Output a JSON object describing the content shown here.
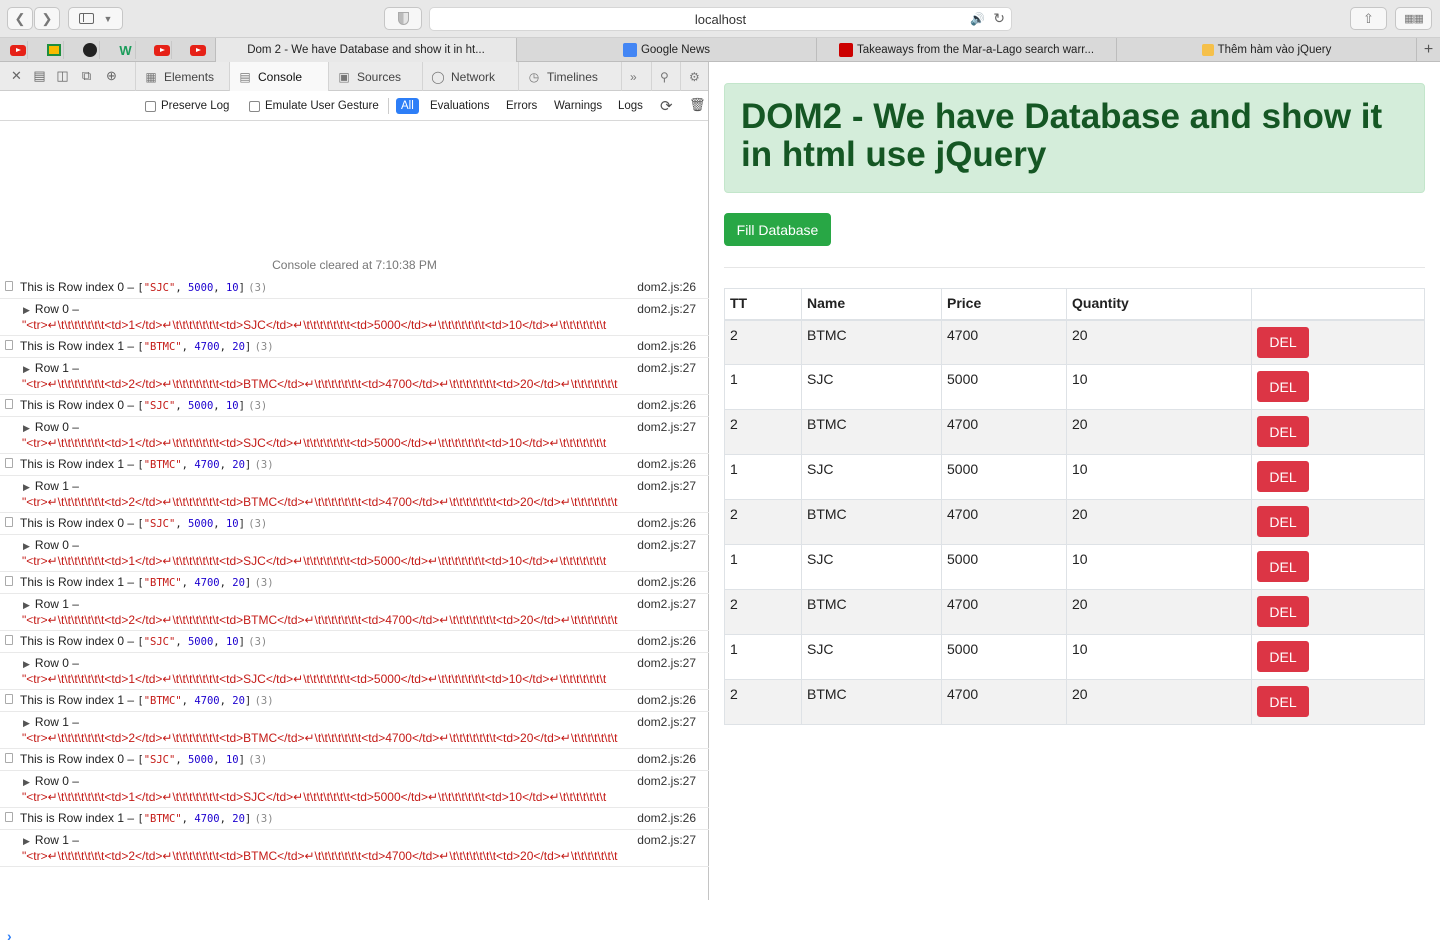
{
  "browser": {
    "url": "localhost",
    "tabs": [
      {
        "title": "Dom 2 - We have Database and show it in ht...",
        "active": true
      },
      {
        "title": "Google News",
        "active": false
      },
      {
        "title": "Takeaways from the Mar-a-Lago search warr...",
        "active": false
      },
      {
        "title": "Thêm hàm vào jQuery",
        "active": false
      }
    ],
    "bookmarks": [
      "youtube-icon",
      "google-classroom-icon",
      "github-icon",
      "w-icon",
      "youtube-icon",
      "youtube-icon"
    ]
  },
  "devtools": {
    "tabs": [
      "Elements",
      "Console",
      "Sources",
      "Network",
      "Timelines"
    ],
    "active_tab": "Console",
    "filters": {
      "preserve_log": "Preserve Log",
      "emulate_gesture": "Emulate User Gesture",
      "levels": [
        "All",
        "Evaluations",
        "Errors",
        "Warnings",
        "Logs"
      ],
      "selected": "All"
    },
    "cleared_message": "Console cleared at 7:10:38 PM",
    "logs": [
      {
        "text": "This is Row index 0 –",
        "arr": [
          "\"SJC\"",
          "5000",
          "10"
        ],
        "count": "(3)",
        "src": "dom2.js:26",
        "label": "Row 0 –",
        "html": "\"<tr>↵\\t\\t\\t\\t\\t\\t\\t<td>1</td>↵\\t\\t\\t\\t\\t\\t\\t<td>SJC</td>↵\\t\\t\\t\\t\\t\\t\\t<td>5000</td>↵\\t\\t\\t\\t\\t\\t\\t<td>10</td>↵\\t\\t\\t\\t\\t\\t\\t",
        "src2": "dom2.js:27"
      },
      {
        "text": "This is Row index 1 –",
        "arr": [
          "\"BTMC\"",
          "4700",
          "20"
        ],
        "count": "(3)",
        "src": "dom2.js:26",
        "label": "Row 1 –",
        "html": "\"<tr>↵\\t\\t\\t\\t\\t\\t\\t<td>2</td>↵\\t\\t\\t\\t\\t\\t\\t<td>BTMC</td>↵\\t\\t\\t\\t\\t\\t\\t<td>4700</td>↵\\t\\t\\t\\t\\t\\t\\t<td>20</td>↵\\t\\t\\t\\t\\t\\t\\t",
        "src2": "dom2.js:27"
      }
    ]
  },
  "page": {
    "heading": "DOM2 - We have Database and show it in html use jQuery",
    "fill_button": "Fill Database",
    "table": {
      "headers": [
        "TT",
        "Name",
        "Price",
        "Quantity",
        ""
      ],
      "rows": [
        [
          "2",
          "BTMC",
          "4700",
          "20"
        ],
        [
          "1",
          "SJC",
          "5000",
          "10"
        ],
        [
          "2",
          "BTMC",
          "4700",
          "20"
        ],
        [
          "1",
          "SJC",
          "5000",
          "10"
        ],
        [
          "2",
          "BTMC",
          "4700",
          "20"
        ],
        [
          "1",
          "SJC",
          "5000",
          "10"
        ],
        [
          "2",
          "BTMC",
          "4700",
          "20"
        ],
        [
          "1",
          "SJC",
          "5000",
          "10"
        ],
        [
          "2",
          "BTMC",
          "4700",
          "20"
        ]
      ],
      "del_label": "DEL"
    }
  },
  "colors": {
    "jumbotron_bg": "#d4edda",
    "jumbotron_text": "#155724",
    "success": "#28a745",
    "danger": "#dc3545",
    "console_string": "#c41a16",
    "console_number": "#1c00cf",
    "devtools_accent": "#2d7ef7"
  }
}
